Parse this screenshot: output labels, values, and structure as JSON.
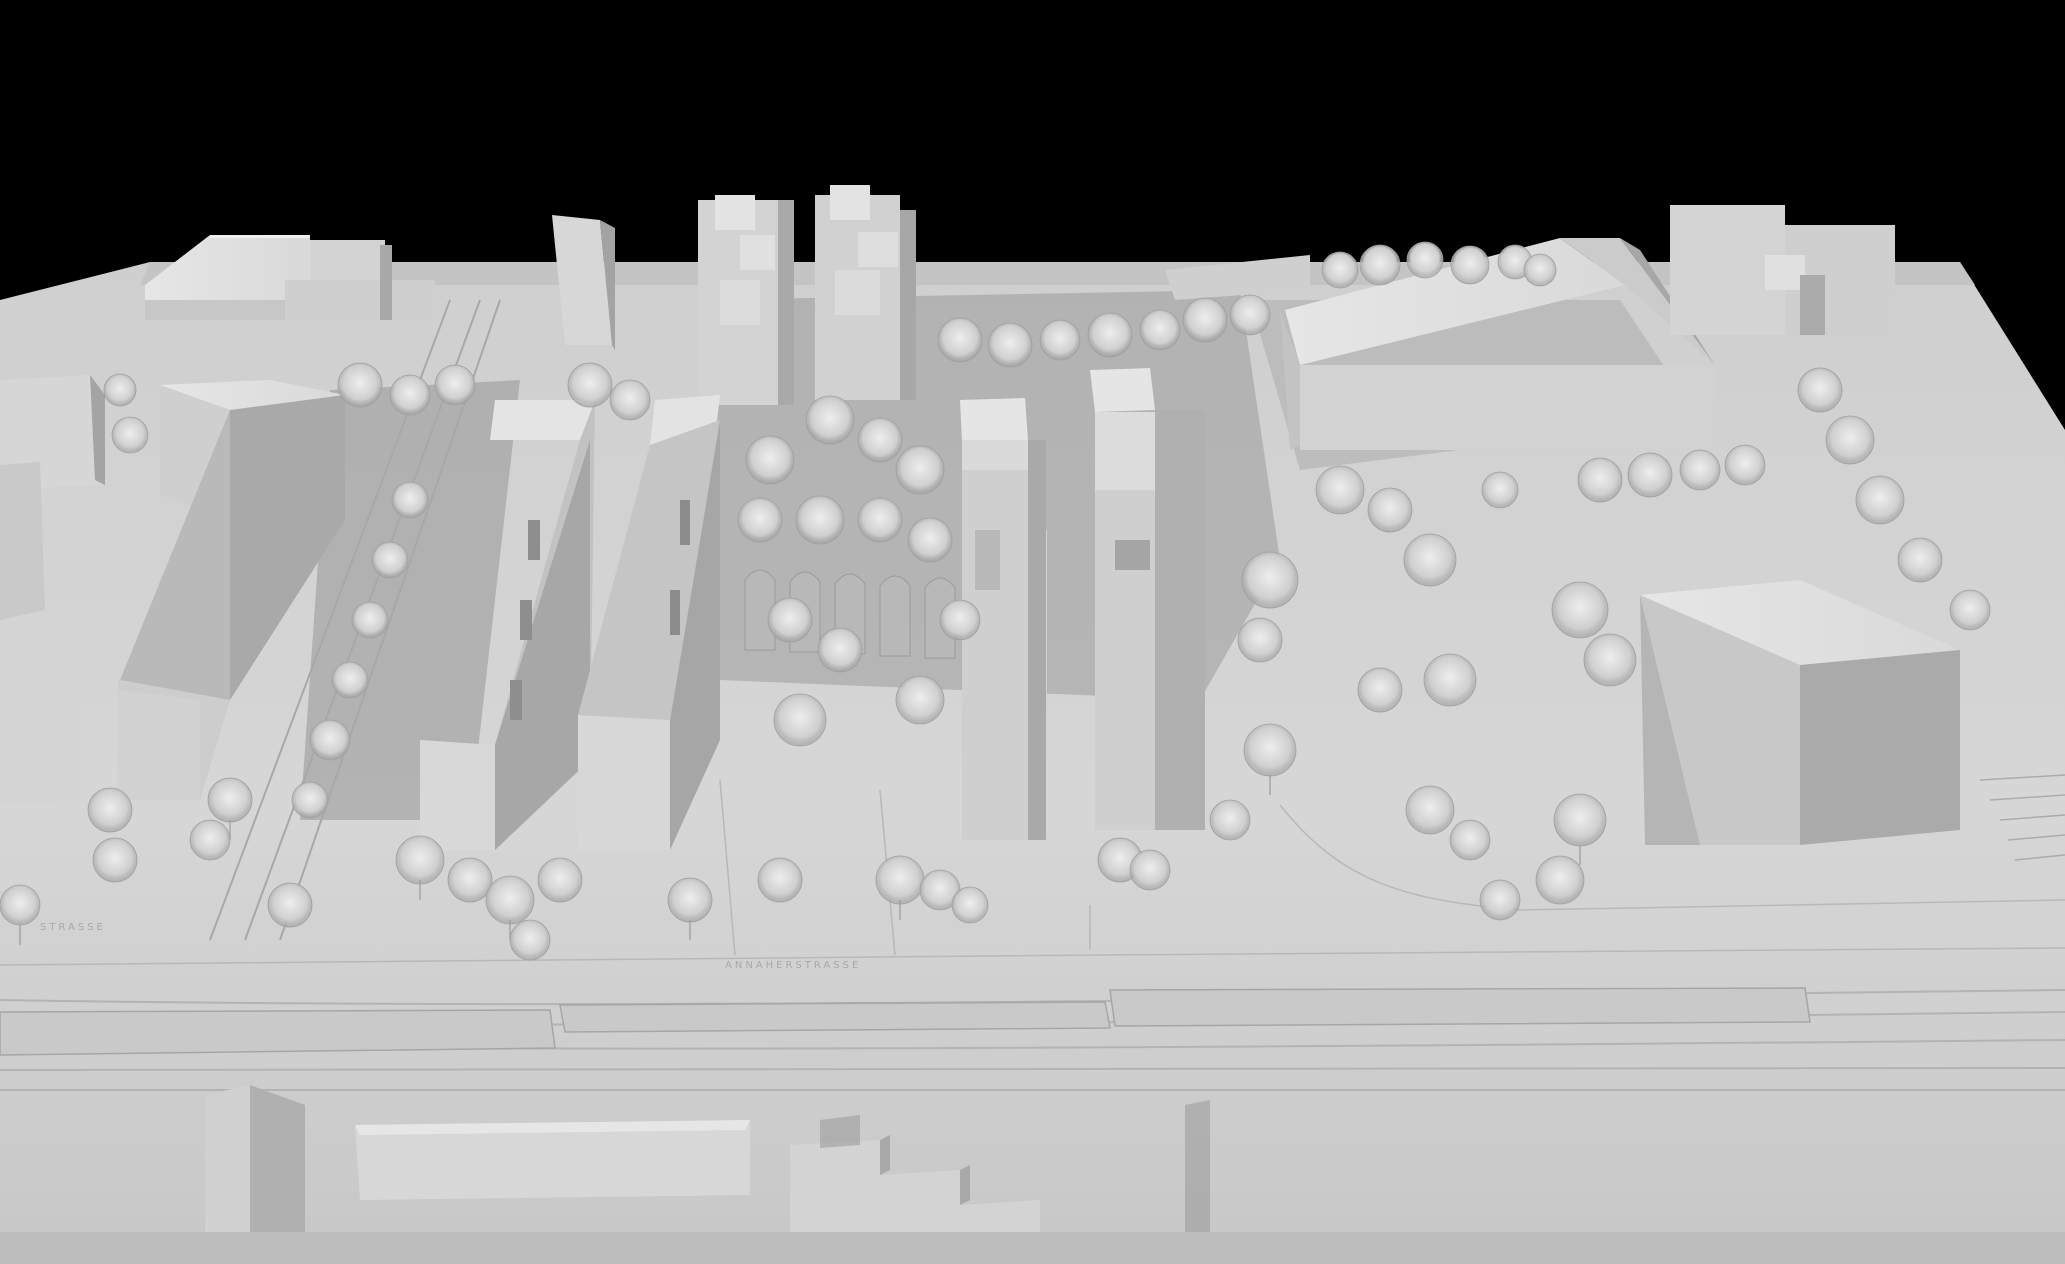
{
  "image": {
    "subject": "architectural-massing-model",
    "background_color": "#000000",
    "model_color": "#d8d8d8",
    "shadow_color": "#6e6e6e"
  },
  "labels": {
    "street_center": "ANNAHERSTRASSE",
    "street_left": "STRASSE"
  }
}
